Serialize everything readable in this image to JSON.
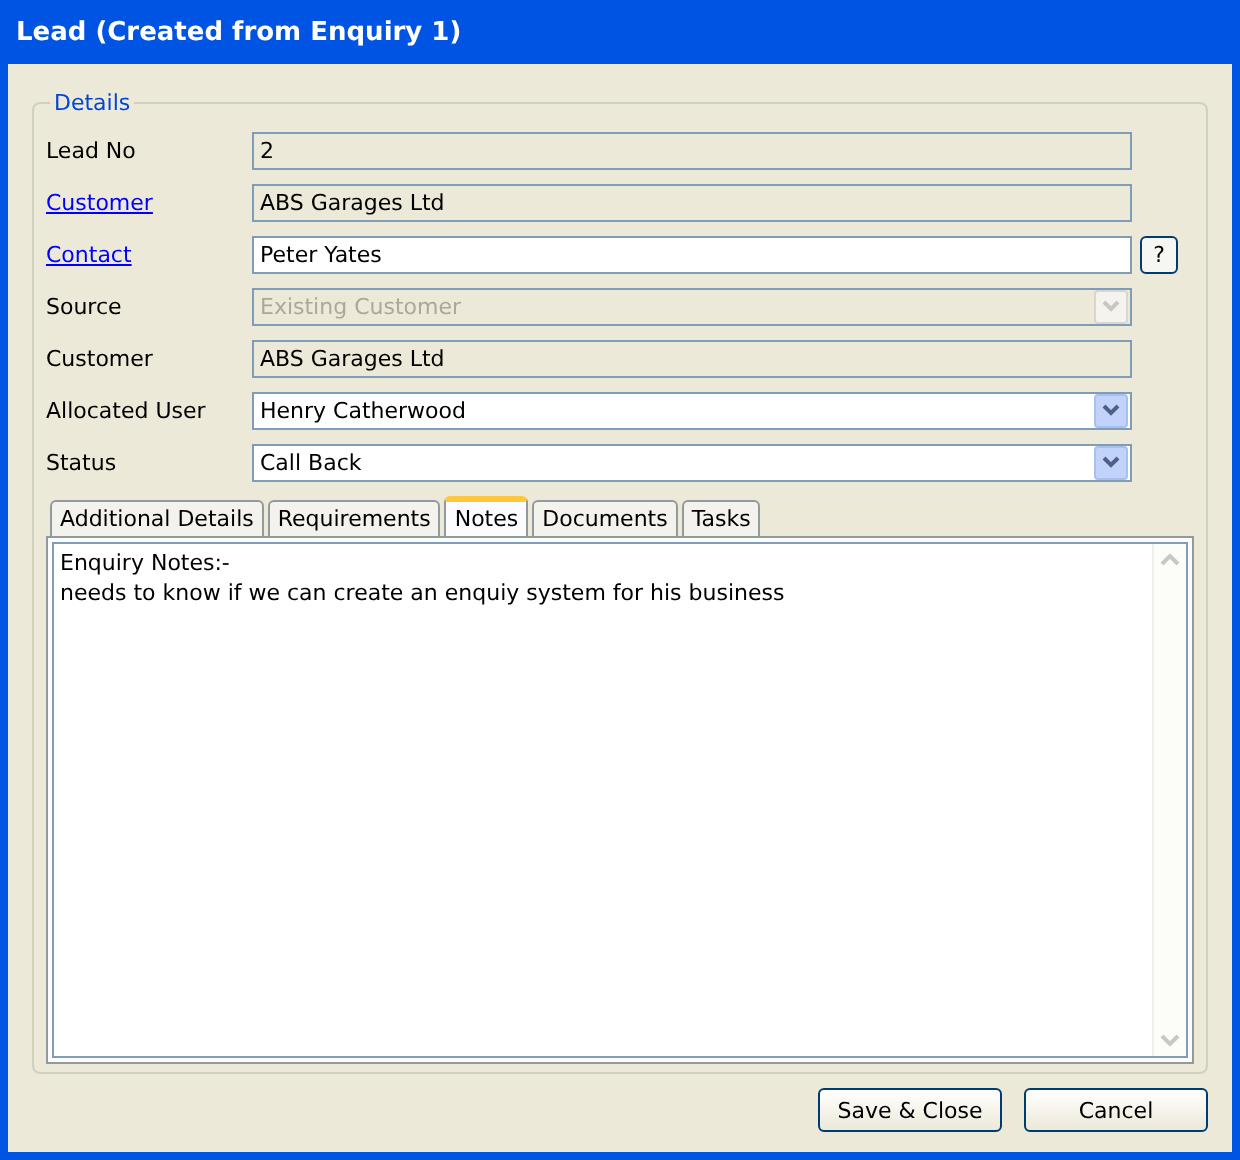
{
  "window": {
    "title": "Lead (Created from Enquiry 1)"
  },
  "details": {
    "legend": "Details",
    "rows": [
      {
        "label": "Lead No",
        "link": false,
        "kind": "readonly",
        "value": "2"
      },
      {
        "label": "Customer",
        "link": true,
        "kind": "readonly",
        "value": "ABS Garages Ltd"
      },
      {
        "label": "Contact",
        "link": true,
        "kind": "text",
        "value": "Peter Yates",
        "help": "?"
      },
      {
        "label": "Source",
        "link": false,
        "kind": "select",
        "value": "Existing Customer",
        "disabled": true
      },
      {
        "label": "Customer",
        "link": false,
        "kind": "readonly",
        "value": "ABS Garages Ltd"
      },
      {
        "label": "Allocated User",
        "link": false,
        "kind": "select",
        "value": "Henry Catherwood",
        "disabled": false
      },
      {
        "label": "Status",
        "link": false,
        "kind": "select",
        "value": "Call Back",
        "disabled": false
      }
    ]
  },
  "tabs": [
    {
      "label": "Additional Details",
      "selected": false
    },
    {
      "label": "Requirements",
      "selected": false
    },
    {
      "label": "Notes",
      "selected": true
    },
    {
      "label": "Documents",
      "selected": false
    },
    {
      "label": "Tasks",
      "selected": false
    }
  ],
  "notes": {
    "lines": [
      "Enquiry Notes:-",
      "needs to know if we can create an enquiy system for his business"
    ]
  },
  "buttons": [
    {
      "label": "Save & Close"
    },
    {
      "label": "Cancel"
    }
  ]
}
